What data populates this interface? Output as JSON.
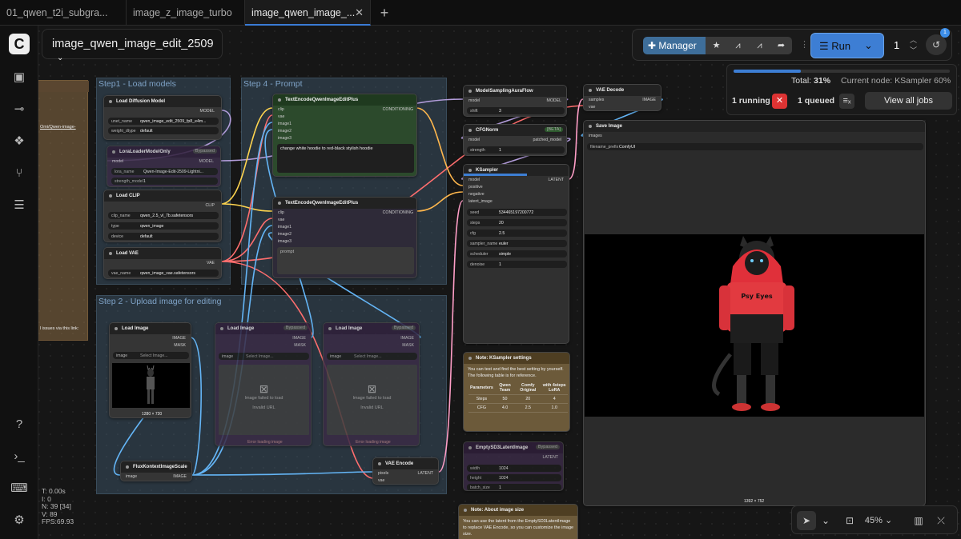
{
  "tabs": [
    {
      "label": "01_qwen_t2i_subgra..."
    },
    {
      "label": "image_z_image_turbo"
    },
    {
      "label": "image_qwen_image_..."
    }
  ],
  "workflow_name": "image_qwen_image_edit_2509",
  "sidebar_icons": [
    "comfy-logo",
    "image-gallery-icon",
    "node-library-icon",
    "model-library-icon",
    "workflows-icon",
    "templates-icon",
    "help-icon",
    "terminal-icon",
    "keyboard-icon",
    "settings-icon"
  ],
  "toolbar": {
    "manager": "Manager",
    "run": "Run",
    "queue_count": "1",
    "history_badge": "1"
  },
  "progress": {
    "fraction": 0.31,
    "total_label": "Total:",
    "total": "31%",
    "current_label": "Current node:",
    "current": "KSampler 60%",
    "running": "1 running",
    "queued": "1 queued",
    "view_all": "View all jobs"
  },
  "zoom": {
    "level": "45%"
  },
  "hud": {
    "t": "T: 0.00s",
    "i": "I: 0",
    "n": "N: 39 [34]",
    "v": "V: 89",
    "fps": "FPS:69.93"
  },
  "groups": {
    "step1": "Step1 - Load models",
    "step4": "Step 4 - Prompt",
    "step2": "Step 2 - Upload image for editing"
  },
  "note_left": {
    "link": "Omi/Qwen-image-",
    "issues": "l issues via this link:"
  },
  "nodes": {
    "load_diffusion": {
      "title": "Load Diffusion Model",
      "out": "MODEL",
      "w1": "unet_name",
      "v1": "qwen_image_edit_2509_fp8_e4m...",
      "w2": "weight_dtype",
      "v2": "default"
    },
    "lora": {
      "title": "LoraLoaderModelOnly",
      "bypass": "Bypassed",
      "in": "model",
      "out": "MODEL",
      "w1": "lora_name",
      "v1": "Qwen-Image-Edit-2509-Lightni...",
      "w2": "strength_model",
      "v2": "1"
    },
    "load_clip": {
      "title": "Load CLIP",
      "out": "CLIP",
      "w1": "clip_name",
      "v1": "qwen_2.5_vl_7b.safetensors",
      "w2": "type",
      "v2": "qwen_image",
      "w3": "device",
      "v3": "default"
    },
    "load_vae": {
      "title": "Load VAE",
      "out": "VAE",
      "w1": "vae_name",
      "v1": "qwen_image_vae.safetensors"
    },
    "te_pos": {
      "title": "TextEncodeQwenImageEditPlus",
      "out": "CONDITIONING",
      "in1": "clip",
      "in2": "vae",
      "in3": "image1",
      "in4": "image2",
      "in5": "image3",
      "prompt": "change white hoodie to red-black stylish hoodie"
    },
    "te_neg": {
      "title": "TextEncodeQwenImageEditPlus",
      "out": "CONDITIONING",
      "in1": "clip",
      "in2": "vae",
      "in3": "image1",
      "in4": "image2",
      "in5": "image3",
      "prompt": "prompt"
    },
    "load_image": {
      "title": "Load Image",
      "out1": "IMAGE",
      "out2": "MASK",
      "w1": "image",
      "v1": "Select Image...",
      "size": "1280 × 720"
    },
    "load_image2": {
      "title": "Load Image",
      "bypass": "Bypassed",
      "out1": "IMAGE",
      "out2": "MASK",
      "w1": "image",
      "v1": "Select Image...",
      "fail": "Image failed to load",
      "invalid": "Invalid URL",
      "err": "Error loading image"
    },
    "load_image3": {
      "title": "Load Image",
      "bypass": "Bypassed",
      "out1": "IMAGE",
      "out2": "MASK",
      "w1": "image",
      "v1": "Select Image...",
      "fail": "Image failed to load",
      "invalid": "Invalid URL",
      "err": "Error loading image"
    },
    "flux_scale": {
      "title": "FluxKontextImageScale",
      "in": "image",
      "out": "IMAGE"
    },
    "vae_encode": {
      "title": "VAE Encode",
      "in1": "pixels",
      "in2": "vae",
      "out": "LATENT"
    },
    "model_sampling": {
      "title": "ModelSamplingAuraFlow",
      "in": "model",
      "out": "MODEL",
      "w1": "shift",
      "v1": "3"
    },
    "cfgnorm": {
      "title": "CFGNorm",
      "beta": "[BETA]",
      "in": "model",
      "out": "patched_model",
      "w1": "strength",
      "v1": "1"
    },
    "ksampler": {
      "title": "KSampler",
      "in1": "model",
      "in2": "positive",
      "in3": "negative",
      "in4": "latent_image",
      "out": "LATENT",
      "w1": "seed",
      "v1": "534465197200772",
      "w2": "steps",
      "v2": "20",
      "w3": "cfg",
      "v3": "2.5",
      "w4": "sampler_name",
      "v4": "euler",
      "w5": "scheduler",
      "v5": "simple",
      "w6": "denoise",
      "v6": "1"
    },
    "vae_decode": {
      "title": "VAE Decode",
      "in1": "samples",
      "in2": "vae",
      "out": "IMAGE"
    },
    "save_image": {
      "title": "Save Image",
      "in": "images",
      "w1": "filename_prefix",
      "v1": "ComfyUI",
      "size": "1392 × 752"
    },
    "note_ks": {
      "title": "Note: KSampler settings",
      "text": "You can test and find the best setting by yourself. The following table is for reference.",
      "headers": [
        "Parameters",
        "Qwen Team",
        "Comfy Original",
        "with 4steps LoRA"
      ],
      "rows": [
        [
          "Steps",
          "50",
          "20",
          "4"
        ],
        [
          "CFG",
          "4.0",
          "2.5",
          "1.0"
        ]
      ]
    },
    "empty_latent": {
      "title": "EmptySD3LatentImage",
      "bypass": "Bypassed",
      "out": "LATENT",
      "w1": "width",
      "v1": "1024",
      "w2": "height",
      "v2": "1024",
      "w3": "batch_size",
      "v3": "1"
    },
    "note_size": {
      "title": "Note: About image size",
      "text": "You can use the latent from the EmptySD3LatentImage to replace VAE Encode, so you can customize the image size."
    }
  },
  "output_image": {
    "caption": "Psy Eyes"
  },
  "colors": {
    "accent": "#3d7ed4",
    "model": "#b39ddb",
    "clip": "#ffd54f",
    "vae": "#ff6e6e",
    "image": "#64b5f6",
    "latent": "#ff9ec7",
    "conditioning": "#ffb74d"
  }
}
